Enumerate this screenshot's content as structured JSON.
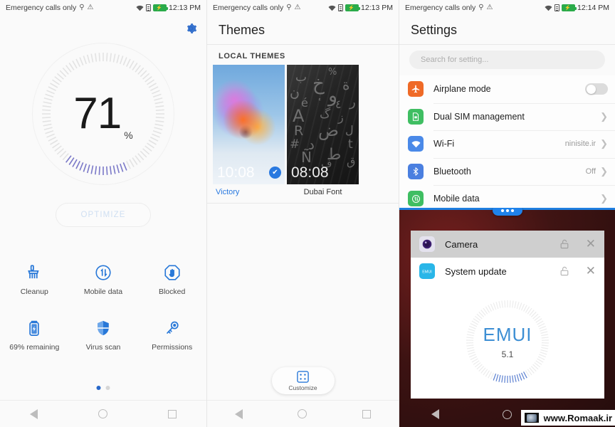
{
  "phone_manager": {
    "status_bar": {
      "carrier": "Emergency calls only",
      "time": "12:13 PM",
      "icons": [
        "usb-icon",
        "warning-icon",
        "wifi-icon",
        "sim-icon",
        "battery-charging-icon"
      ]
    },
    "gear_icon": "gear-icon",
    "score": "71",
    "score_unit": "%",
    "optimize_label": "OPTIMIZE",
    "tiles": [
      {
        "label": "Cleanup",
        "icon": "broom-icon"
      },
      {
        "label": "Mobile data",
        "icon": "data-usage-icon"
      },
      {
        "label": "Blocked",
        "icon": "hand-stop-icon"
      },
      {
        "label": "69% remaining",
        "icon": "battery-icon"
      },
      {
        "label": "Virus scan",
        "icon": "shield-icon"
      },
      {
        "label": "Permissions",
        "icon": "key-icon"
      }
    ],
    "page_dots": {
      "count": 2,
      "active": 0
    }
  },
  "themes": {
    "status_bar": {
      "carrier": "Emergency calls only",
      "time": "12:13 PM"
    },
    "title": "Themes",
    "section_label": "LOCAL THEMES",
    "items": [
      {
        "name": "Victory",
        "preview_time": "10:08",
        "selected": true
      },
      {
        "name": "Dubai Font",
        "preview_time": "08:08",
        "selected": false
      }
    ],
    "customize_label": "Customize",
    "customize_icon": "grid-customize-icon"
  },
  "settings": {
    "status_bar": {
      "carrier": "Emergency calls only",
      "time": "12:14 PM"
    },
    "title": "Settings",
    "search_placeholder": "Search for setting...",
    "rows": [
      {
        "label": "Airplane mode",
        "icon": "airplane-icon",
        "color": "#ef6a27",
        "control": "toggle",
        "toggle_on": false,
        "value": ""
      },
      {
        "label": "Dual SIM management",
        "icon": "sim-card-icon",
        "color": "#3fbe62",
        "control": "chevron",
        "value": ""
      },
      {
        "label": "Wi-Fi",
        "icon": "wifi-icon",
        "color": "#4a89e8",
        "control": "chevron",
        "value": "ninisite.ir"
      },
      {
        "label": "Bluetooth",
        "icon": "bluetooth-icon",
        "color": "#4a7fe0",
        "control": "chevron",
        "value": "Off"
      },
      {
        "label": "Mobile data",
        "icon": "data-usage-icon",
        "color": "#3fbe62",
        "control": "chevron",
        "value": ""
      }
    ]
  },
  "recents": {
    "pill_icon": "more-dots-icon",
    "cards": [
      {
        "name": "Camera",
        "icon": "camera-icon",
        "lock_icon": "unlock-icon",
        "close_icon": "close-icon"
      },
      {
        "name": "System update",
        "icon": "system-update-icon",
        "lock_icon": "unlock-icon",
        "close_icon": "close-icon"
      }
    ],
    "emui_logo": "EMUI",
    "emui_version": "5.1"
  },
  "watermark": {
    "text": "www.Romaak.ir"
  },
  "nav_bar": {
    "back": "back-icon",
    "home": "home-icon",
    "recents": "recents-icon"
  },
  "colors": {
    "accent_blue": "#2767c9",
    "link_blue": "#2979e0",
    "battery_green": "#2aab4a"
  }
}
